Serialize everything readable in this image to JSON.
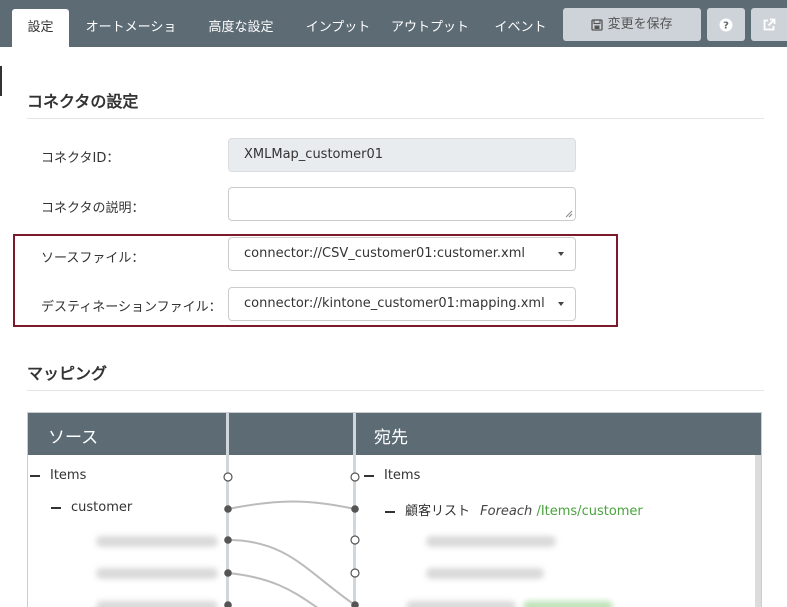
{
  "tabs": [
    {
      "label": "設定",
      "active": true
    },
    {
      "label": "オートメーション",
      "active": false
    },
    {
      "label": "高度な設定",
      "active": false
    },
    {
      "label": "インプット",
      "active": false
    },
    {
      "label": "アウトプット",
      "active": false
    },
    {
      "label": "イベント",
      "active": false
    }
  ],
  "toolbar": {
    "save_label": "変更を保存",
    "save_icon": "save-icon",
    "help_icon": "question-circle-icon",
    "popout_icon": "external-link-icon"
  },
  "connector_settings": {
    "title": "コネクタの設定",
    "fields": {
      "connector_id": {
        "label": "コネクタID：",
        "value": "XMLMap_customer01"
      },
      "description": {
        "label": "コネクタの説明：",
        "value": ""
      },
      "source_file": {
        "label": "ソースファイル：",
        "value": "connector://CSV_customer01:customer.xml"
      },
      "destination_file": {
        "label": "デスティネーションファイル：",
        "value": "connector://kintone_customer01:mapping.xml"
      }
    }
  },
  "mapping": {
    "title": "マッピング",
    "source_header": "ソース",
    "dest_header": "宛先",
    "source_items": [
      {
        "label": "Items"
      },
      {
        "label": "customer"
      }
    ],
    "dest_items": [
      {
        "label": "Items"
      },
      {
        "label": "顧客リスト",
        "loop": "Foreach",
        "path": "/Items/customer"
      }
    ]
  },
  "colors": {
    "tabbar_bg": "#5d6b75",
    "button_bg": "#cdd3d8",
    "highlight_border": "#7b1a2a",
    "path_green": "#4aa33d"
  }
}
